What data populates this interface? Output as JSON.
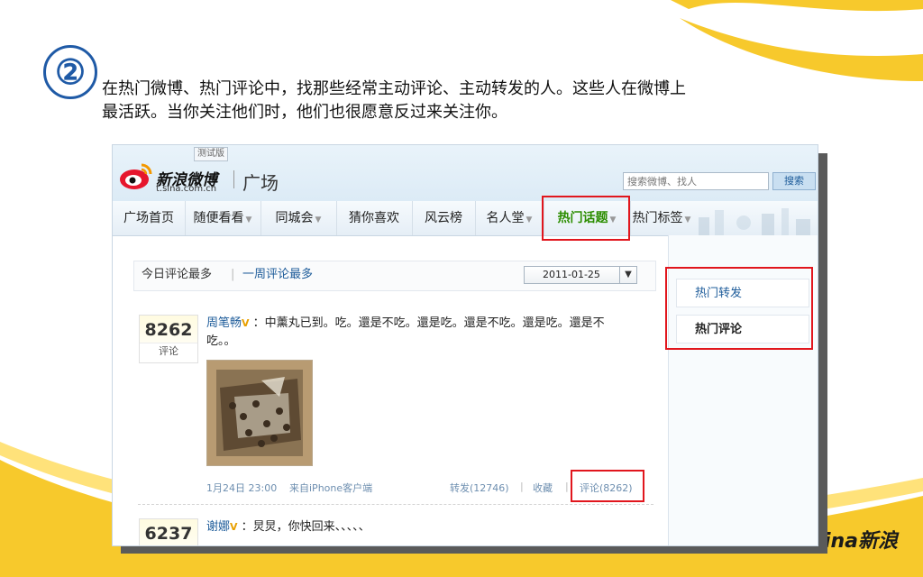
{
  "slide": {
    "step_number": "②",
    "intro_line1": "在热门微博、热门评论中，找那些经常主动评论、主动转发的人。这些人在微博上",
    "intro_line2": "最活跃。当你关注他们时，他们也很愿意反过来关注你。",
    "corner_logo_text": "sina新浪"
  },
  "header": {
    "beta_label": "测试版",
    "brand_title": "新浪微博",
    "brand_url": "t.sina.com.cn",
    "page_name": "广场",
    "search_placeholder": "搜索微博、找人",
    "search_button": "搜索"
  },
  "nav": {
    "items": [
      {
        "label": "广场首页",
        "has_caret": false
      },
      {
        "label": "随便看看",
        "has_caret": true
      },
      {
        "label": "同城会",
        "has_caret": true
      },
      {
        "label": "猜你喜欢",
        "has_caret": false
      },
      {
        "label": "风云榜",
        "has_caret": false
      },
      {
        "label": "名人堂",
        "has_caret": true
      },
      {
        "label": "热门话题",
        "has_caret": true,
        "active": true
      },
      {
        "label": "热门标签",
        "has_caret": true
      }
    ]
  },
  "tabs": {
    "today_most_comments": "今日评论最多",
    "separator": "|",
    "week_most_comments": "一周评论最多",
    "date_value": "2011-01-25"
  },
  "posts": [
    {
      "count": "8262",
      "count_label": "评论",
      "user": "周笔畅",
      "verified": "V",
      "text_line1": "：中薰丸已到。吃。還是不吃。還是吃。還是不吃。還是吃。還是不",
      "text_line2": "吃。。",
      "time": "1月24日 23:00",
      "source": "来自iPhone客户端",
      "repost": "转发(12746)",
      "sep1": "|",
      "favorite": "收藏",
      "sep2": "|",
      "comment": "评论(8262)"
    },
    {
      "count": "6237",
      "user": "谢娜",
      "verified": "V",
      "text_line1": "：炅炅，你快回来、、、、、"
    }
  ],
  "sidebar": {
    "items": [
      {
        "label": "热门转发"
      },
      {
        "label": "热门评论"
      }
    ]
  },
  "colors": {
    "highlight_red": "#e1161d",
    "link_blue": "#1e5c9a",
    "active_green": "#2b8d00",
    "slide_yellow": "#f5c518"
  }
}
